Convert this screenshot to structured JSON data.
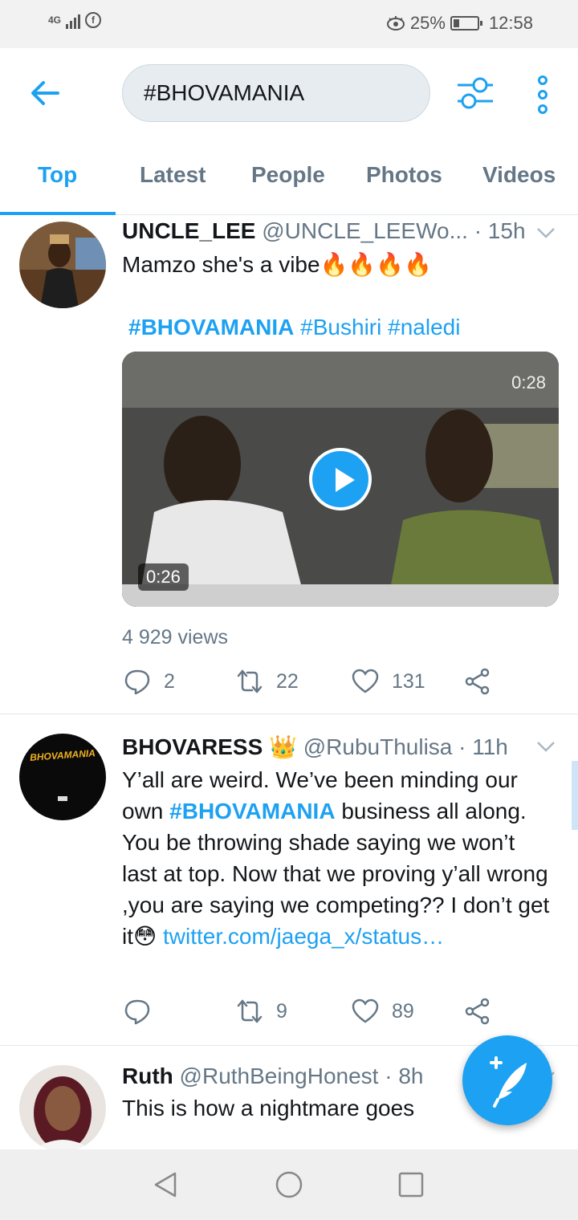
{
  "status_bar": {
    "network": "4G",
    "facebook_icon": "f",
    "battery_level": 0.25,
    "battery_percent": "25%",
    "time": "12:58"
  },
  "header": {
    "search_value": "#BHOVAMANIA"
  },
  "tabs": [
    {
      "label": "Top",
      "active": true
    },
    {
      "label": "Latest"
    },
    {
      "label": "People"
    },
    {
      "label": "Photos"
    },
    {
      "label": "Videos"
    }
  ],
  "tweets": [
    {
      "display_name": "UNCLE_LEE",
      "handle": "@UNCLE_LEEWo...",
      "time": "· 15h",
      "text": "Mamzo she's a vibe🔥🔥🔥🔥",
      "hashtags": [
        "#BHOVAMANIA",
        "#Bushiri",
        "#naledi"
      ],
      "video": {
        "duration": "0:28",
        "elapsed": "0:26"
      },
      "views": "4 929 views",
      "replies": "2",
      "retweets": "22",
      "likes": "131"
    },
    {
      "display_name": "BHOVARESS",
      "name_badge": "👑",
      "handle": "@RubuThulisa",
      "time": "· 11h",
      "avatar_text": "BHOVAMANIA",
      "text_before": "Y’all are weird. We’ve been minding our own ",
      "hashtag": "#BHOVAMANIA",
      "text_after": " business all along. You be throwing shade saying we won’t last at top. Now that we proving y’all wrong ,you are saying we competing?? I don’t get it😳 ",
      "link": "twitter.com/jaega_x/status…",
      "replies": "",
      "retweets": "9",
      "likes": "89"
    },
    {
      "display_name": "Ruth",
      "handle": "@RuthBeingHonest",
      "time": "· 8h",
      "text": "This is how a nightmare goes"
    }
  ],
  "colors": {
    "accent": "#1da1f2",
    "secondary_text": "#657786",
    "primary_text": "#14171a"
  }
}
